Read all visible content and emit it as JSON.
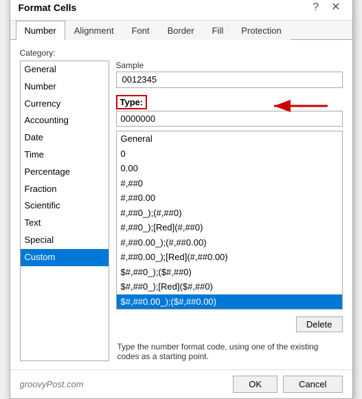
{
  "dialog": {
    "title": "Format Cells",
    "help_btn": "?",
    "close_btn": "✕"
  },
  "tabs": [
    {
      "id": "number",
      "label": "Number",
      "active": true
    },
    {
      "id": "alignment",
      "label": "Alignment",
      "active": false
    },
    {
      "id": "font",
      "label": "Font",
      "active": false
    },
    {
      "id": "border",
      "label": "Border",
      "active": false
    },
    {
      "id": "fill",
      "label": "Fill",
      "active": false
    },
    {
      "id": "protection",
      "label": "Protection",
      "active": false
    }
  ],
  "number_tab": {
    "category_label": "Category:",
    "categories": [
      {
        "label": "General",
        "selected": false
      },
      {
        "label": "Number",
        "selected": false
      },
      {
        "label": "Currency",
        "selected": false
      },
      {
        "label": "Accounting",
        "selected": false
      },
      {
        "label": "Date",
        "selected": false
      },
      {
        "label": "Time",
        "selected": false
      },
      {
        "label": "Percentage",
        "selected": false
      },
      {
        "label": "Fraction",
        "selected": false
      },
      {
        "label": "Scientific",
        "selected": false
      },
      {
        "label": "Text",
        "selected": false
      },
      {
        "label": "Special",
        "selected": false
      },
      {
        "label": "Custom",
        "selected": true
      }
    ],
    "sample_label": "Sample",
    "sample_value": "0012345",
    "type_label": "Type:",
    "type_value": "0000000",
    "format_list": [
      "General",
      "0",
      "0.00",
      "#,##0",
      "#,##0.00",
      "#,##0_);(#,##0)",
      "#,##0_);[Red](#,##0)",
      "#,##0.00_);(#,##0.00)",
      "#,##0.00_);[Red](#,##0.00)",
      "$#,##0_);($#,##0)",
      "$#,##0_);[Red]($#,##0)",
      "$#,##0.00_);($#,##0.00)"
    ],
    "selected_format": "$#,##0.00_);($#,##0.00)",
    "delete_btn": "Delete",
    "hint": "Type the number format code, using one of the existing codes as a starting point."
  },
  "footer": {
    "watermark": "groovyPost.com",
    "ok_btn": "OK",
    "cancel_btn": "Cancel"
  }
}
